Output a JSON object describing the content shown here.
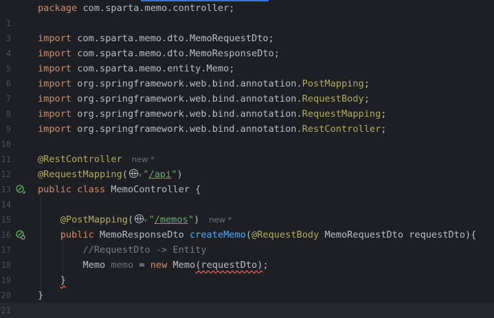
{
  "editor": {
    "lines": [
      {
        "num": "",
        "tokens": [
          {
            "t": "package ",
            "c": "kw"
          },
          {
            "t": "com.sparta.memo.controller;",
            "c": "var"
          }
        ]
      },
      {
        "num": "1",
        "tokens": []
      },
      {
        "num": "3",
        "tokens": [
          {
            "t": "import ",
            "c": "kw"
          },
          {
            "t": "com.sparta.memo.dto.MemoRequestDto;",
            "c": "var"
          }
        ]
      },
      {
        "num": "4",
        "tokens": [
          {
            "t": "import ",
            "c": "kw"
          },
          {
            "t": "com.sparta.memo.dto.MemoResponseDto;",
            "c": "var"
          }
        ]
      },
      {
        "num": "5",
        "tokens": [
          {
            "t": "import ",
            "c": "kw"
          },
          {
            "t": "com.sparta.memo.entity.Memo;",
            "c": "var"
          }
        ]
      },
      {
        "num": "6",
        "tokens": [
          {
            "t": "import ",
            "c": "kw"
          },
          {
            "t": "org.springframework.web.bind.annotation.",
            "c": "var"
          },
          {
            "t": "PostMapping",
            "c": "ann"
          },
          {
            "t": ";",
            "c": "var"
          }
        ]
      },
      {
        "num": "7",
        "tokens": [
          {
            "t": "import ",
            "c": "kw"
          },
          {
            "t": "org.springframework.web.bind.annotation.",
            "c": "var"
          },
          {
            "t": "RequestBody",
            "c": "ann"
          },
          {
            "t": ";",
            "c": "var"
          }
        ]
      },
      {
        "num": "8",
        "tokens": [
          {
            "t": "import ",
            "c": "kw"
          },
          {
            "t": "org.springframework.web.bind.annotation.",
            "c": "var"
          },
          {
            "t": "RequestMapping",
            "c": "ann"
          },
          {
            "t": ";",
            "c": "var"
          }
        ]
      },
      {
        "num": "9",
        "tokens": [
          {
            "t": "import ",
            "c": "kw"
          },
          {
            "t": "org.springframework.web.bind.annotation.",
            "c": "var"
          },
          {
            "t": "RestController",
            "c": "ann"
          },
          {
            "t": ";",
            "c": "var"
          }
        ]
      },
      {
        "num": "10",
        "tokens": []
      },
      {
        "num": "11",
        "tokens": [
          {
            "t": "@RestController",
            "c": "ann"
          },
          {
            "t": "new *",
            "c": "hint"
          }
        ]
      },
      {
        "num": "12",
        "tokens": [
          {
            "t": "@RequestMapping",
            "c": "ann"
          },
          {
            "t": "(",
            "c": "var"
          },
          {
            "t": "",
            "c": "globe"
          },
          {
            "t": "˅",
            "c": "chev"
          },
          {
            "t": "\"",
            "c": "strq"
          },
          {
            "t": "/api",
            "c": "str"
          },
          {
            "t": "\"",
            "c": "strq"
          },
          {
            "t": ")",
            "c": "var"
          }
        ]
      },
      {
        "num": "13",
        "icon": "bean-class-icon",
        "tokens": [
          {
            "t": "public ",
            "c": "kw"
          },
          {
            "t": "class ",
            "c": "kw"
          },
          {
            "t": "MemoController {",
            "c": "var"
          }
        ]
      },
      {
        "num": "14",
        "tokens": []
      },
      {
        "num": "15",
        "tokens": [
          {
            "t": "    ",
            "c": "var"
          },
          {
            "t": "@PostMapping",
            "c": "ann"
          },
          {
            "t": "(",
            "c": "var"
          },
          {
            "t": "",
            "c": "globe"
          },
          {
            "t": "˅",
            "c": "chev"
          },
          {
            "t": "\"",
            "c": "strq"
          },
          {
            "t": "/memos",
            "c": "str"
          },
          {
            "t": "\"",
            "c": "strq"
          },
          {
            "t": ")",
            "c": "var"
          },
          {
            "t": "new *",
            "c": "hint"
          }
        ]
      },
      {
        "num": "16",
        "icon": "request-mapping-icon",
        "tokens": [
          {
            "t": "    ",
            "c": "var"
          },
          {
            "t": "public ",
            "c": "kw"
          },
          {
            "t": "MemoResponseDto ",
            "c": "var"
          },
          {
            "t": "createMemo",
            "c": "fn"
          },
          {
            "t": "(",
            "c": "var"
          },
          {
            "t": "@RequestBody ",
            "c": "ann"
          },
          {
            "t": "MemoRequestDto requestDto){",
            "c": "var"
          }
        ]
      },
      {
        "num": "17",
        "tokens": [
          {
            "t": "        ",
            "c": "var"
          },
          {
            "t": "//RequestDto -> Entity",
            "c": "cmt"
          }
        ]
      },
      {
        "num": "18",
        "tokens": [
          {
            "t": "        ",
            "c": "var"
          },
          {
            "t": "Memo ",
            "c": "var"
          },
          {
            "t": "memo",
            "c": "unused"
          },
          {
            "t": " = ",
            "c": "var"
          },
          {
            "t": "new ",
            "c": "kw"
          },
          {
            "t": "Memo",
            "c": "var"
          },
          {
            "t": "(requestDto)",
            "c": "squiggle"
          },
          {
            "t": ";",
            "c": "var"
          }
        ]
      },
      {
        "num": "19",
        "tokens": [
          {
            "t": "    ",
            "c": "var"
          },
          {
            "t": "}",
            "c": "squiggle"
          }
        ]
      },
      {
        "num": "20",
        "tokens": [
          {
            "t": "}",
            "c": "var"
          }
        ]
      },
      {
        "num": "21",
        "tokens": []
      }
    ]
  }
}
